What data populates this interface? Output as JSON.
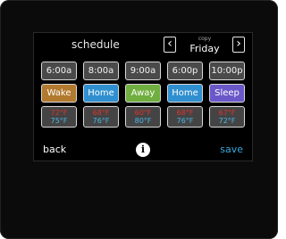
{
  "screen": {
    "title": "schedule",
    "copy_label": "copy",
    "day": "Friday",
    "prev_icon": "chevron-left",
    "next_icon": "chevron-right"
  },
  "periods": [
    {
      "time": "6:00a",
      "mode": "Wake",
      "mode_color": "#b27a2e",
      "heat": "72°F",
      "cool": "75°F"
    },
    {
      "time": "8:00a",
      "mode": "Home",
      "mode_color": "#2f8fcf",
      "heat": "68°F",
      "cool": "76°F"
    },
    {
      "time": "9:00a",
      "mode": "Away",
      "mode_color": "#6fae3f",
      "heat": "60°F",
      "cool": "80°F"
    },
    {
      "time": "6:00p",
      "mode": "Home",
      "mode_color": "#2f8fcf",
      "heat": "68°F",
      "cool": "76°F"
    },
    {
      "time": "10:00p",
      "mode": "Sleep",
      "mode_color": "#6a58c9",
      "heat": "67°F",
      "cool": "72°F"
    }
  ],
  "footer": {
    "back_label": "back",
    "info_label": "i",
    "save_label": "save"
  }
}
